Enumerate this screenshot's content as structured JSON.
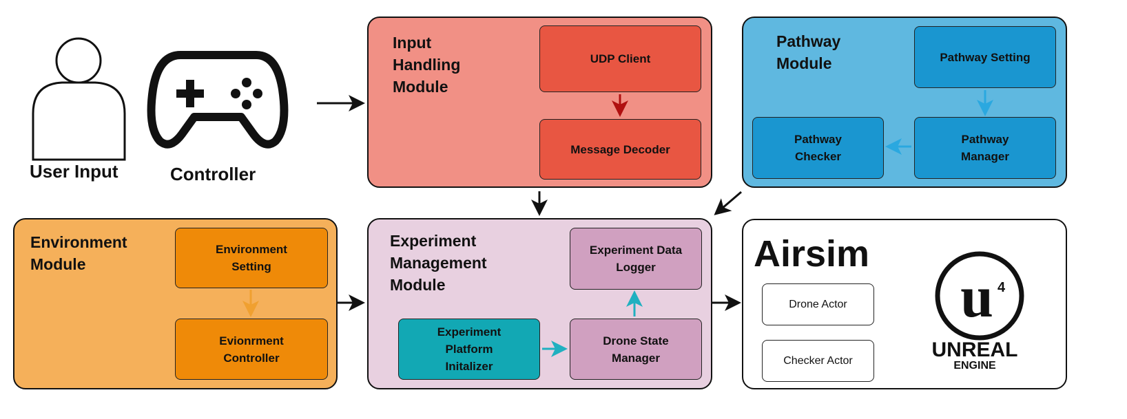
{
  "actors": {
    "user": "User Input",
    "controller": "Controller"
  },
  "input_module": {
    "title": "Input\nHandling\nModule",
    "udp_client": "UDP Client",
    "message_decoder": "Message Decoder",
    "fill": "#F19085",
    "sub_fill": "#E85642"
  },
  "pathway_module": {
    "title": "Pathway\nModule",
    "setting": "Pathway Setting",
    "manager": "Pathway\nManager",
    "checker": "Pathway\nChecker",
    "fill": "#5FB8E0",
    "sub_fill": "#1A96D0"
  },
  "environment_module": {
    "title": "Environment\nModule",
    "setting": "Environment\nSetting",
    "controller": "Evionrment\nController",
    "fill": "#F5B05A",
    "sub_fill": "#EF8A08"
  },
  "experiment_module": {
    "title": "Experiment\nManagement\nModule",
    "logger": "Experiment Data\nLogger",
    "state_manager": "Drone State\nManager",
    "platform_initializer": "Experiment\nPlatform\nInitalizer",
    "fill": "#E8D0E0",
    "sub_fill": "#D0A0C0",
    "teal": "#12A8B4"
  },
  "airsim": {
    "title": "Airsim",
    "drone_actor": "Drone Actor",
    "checker_actor": "Checker Actor",
    "logo_text": "UNREAL ENGINE"
  }
}
